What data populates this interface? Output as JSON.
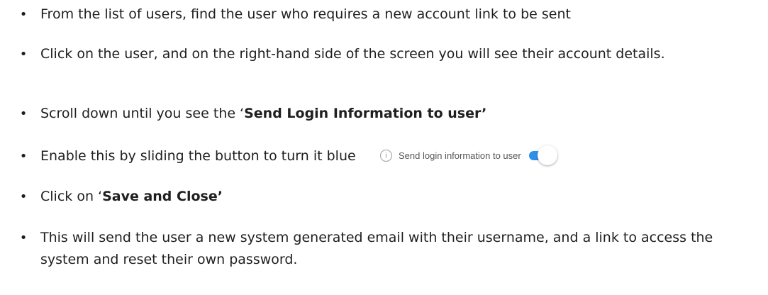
{
  "bullet_symbol": "•",
  "steps": [
    {
      "text": "From the list of users, find the user who requires a new account link to be sent"
    },
    {
      "text": "Click on the user, and on the right-hand side of the screen you will see their account details."
    },
    {
      "prefix": "Scroll down until you see the ‘",
      "bold": "Send Login Information to user’"
    },
    {
      "text": "Enable this by sliding the button to turn it blue"
    },
    {
      "prefix": "Click on ‘",
      "bold": "Save and Close’"
    },
    {
      "text": "This will send the user a new system generated email with their username, and a link to access the system and reset their own password."
    }
  ],
  "toggle": {
    "info_icon": "info-icon",
    "info_glyph": "i",
    "label": "Send login information to user",
    "state": "on",
    "on_color": "#2f8fe9"
  }
}
